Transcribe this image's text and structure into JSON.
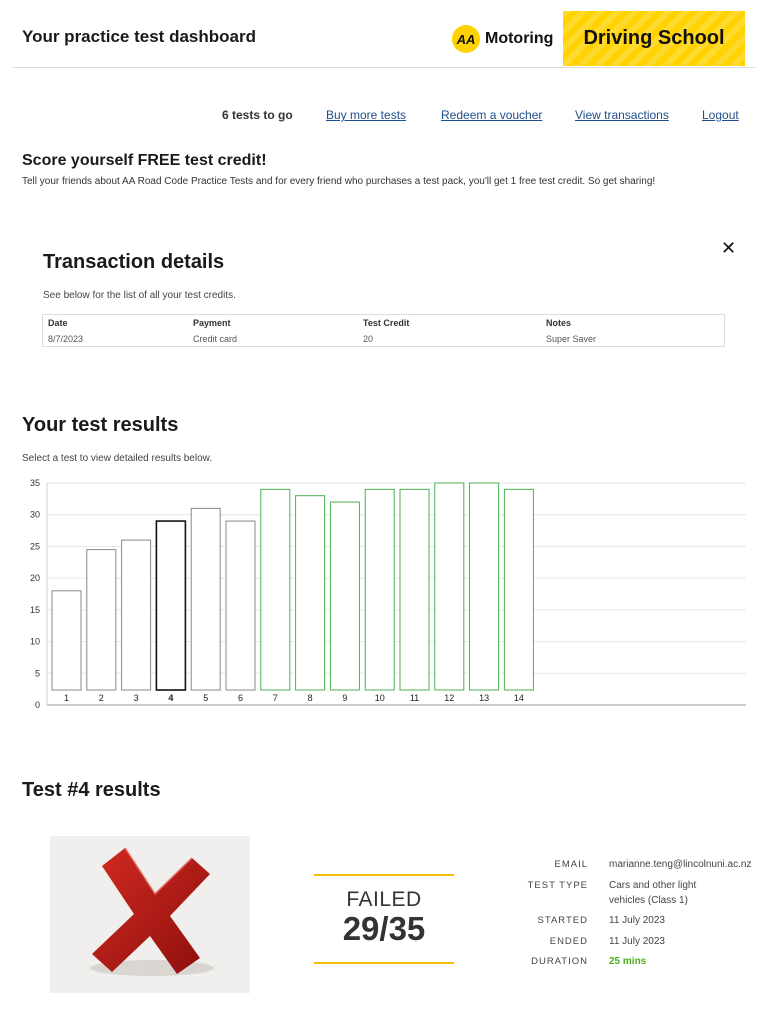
{
  "header": {
    "title": "Your practice test dashboard",
    "aa_badge": "AA",
    "brand_text": "Motoring",
    "driving_school": "Driving School"
  },
  "nav": {
    "tests_to_go": "6 tests to go",
    "buy_more": "Buy more tests",
    "redeem": "Redeem a voucher",
    "view_transactions": "View transactions",
    "logout": "Logout"
  },
  "promo": {
    "title": "Score yourself FREE test credit!",
    "text": "Tell your friends about AA Road Code Practice Tests and for every friend who purchases a test pack, you'll get 1 free test credit. So get sharing!"
  },
  "transactions": {
    "title": "Transaction details",
    "close_icon": "✕",
    "subtitle": "See below for the list of all your test credits.",
    "columns": [
      "Date",
      "Payment",
      "Test Credit",
      "Notes"
    ],
    "rows": [
      [
        "8/7/2023",
        "Credit card",
        "20",
        "Super Saver"
      ]
    ]
  },
  "results": {
    "title": "Your test results",
    "subtitle": "Select a test to view detailed results below."
  },
  "chart_data": {
    "type": "bar",
    "categories": [
      "1",
      "2",
      "3",
      "4",
      "5",
      "6",
      "7",
      "8",
      "9",
      "10",
      "11",
      "12",
      "13",
      "14"
    ],
    "values": [
      18,
      24.5,
      26,
      29,
      31,
      29,
      34,
      33,
      32,
      34,
      34,
      35,
      35,
      34
    ],
    "passed": [
      false,
      false,
      false,
      false,
      false,
      false,
      true,
      true,
      true,
      true,
      true,
      true,
      true,
      true
    ],
    "selected_index": 3,
    "yticks": [
      0,
      5,
      10,
      15,
      20,
      25,
      30,
      35
    ],
    "ylim": [
      0,
      35
    ],
    "grid": true,
    "colors": {
      "pass": "#4caf50",
      "fail": "#888888",
      "selected": "#111111"
    }
  },
  "test_result": {
    "title": "Test #4 results",
    "status": "FAILED",
    "score": "29/35",
    "fields": [
      {
        "label": "EMAIL",
        "value": [
          "marianne.teng@lincolnuni.ac.nz"
        ]
      },
      {
        "label": "TEST TYPE",
        "value": [
          "Cars and other light",
          "vehicles (Class 1)"
        ]
      },
      {
        "label": "STARTED",
        "value": [
          "11 July 2023"
        ]
      },
      {
        "label": "ENDED",
        "value": [
          "11 July 2023"
        ]
      },
      {
        "label": "DURATION",
        "value": [
          "25 mins"
        ]
      }
    ]
  }
}
